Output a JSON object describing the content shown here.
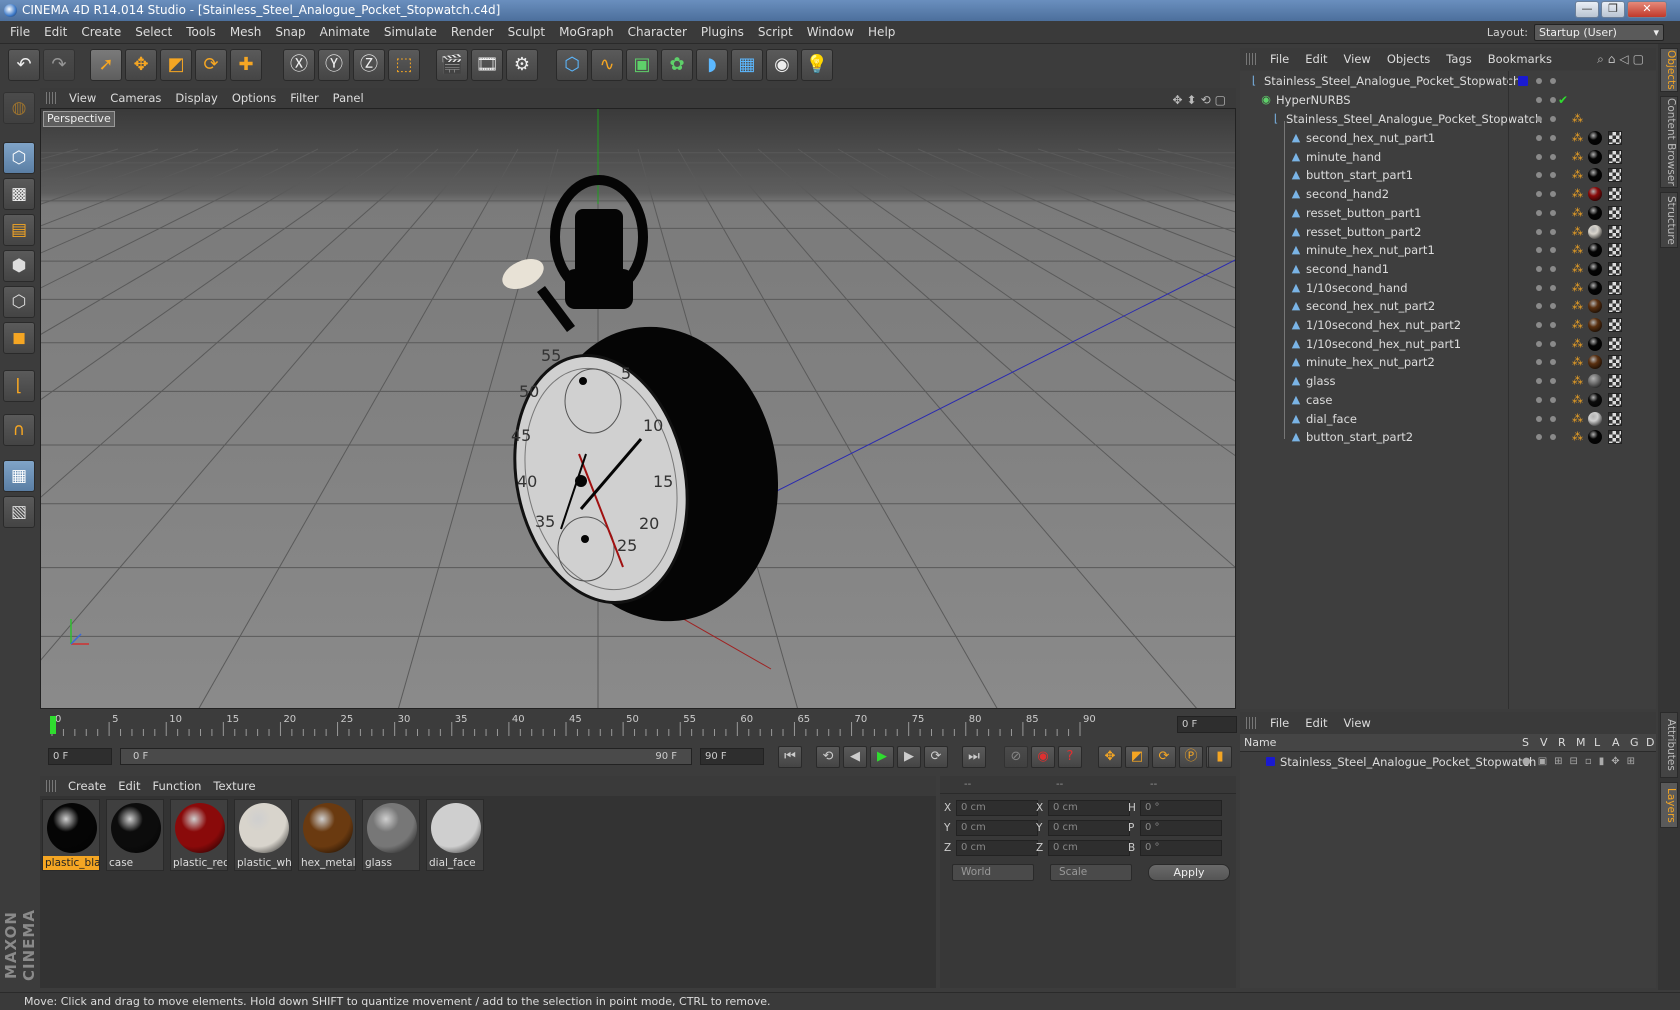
{
  "window": {
    "title": "CINEMA 4D R14.014 Studio - [Stainless_Steel_Analogue_Pocket_Stopwatch.c4d]",
    "minimize": "—",
    "maximize": "❐",
    "close": "✕"
  },
  "menu": [
    "File",
    "Edit",
    "Create",
    "Select",
    "Tools",
    "Mesh",
    "Snap",
    "Animate",
    "Simulate",
    "Render",
    "Sculpt",
    "MoGraph",
    "Character",
    "Plugins",
    "Script",
    "Window",
    "Help"
  ],
  "layout": {
    "label": "Layout:",
    "value": "Startup (User)"
  },
  "toolbar_icons": [
    "undo-icon",
    "redo-icon",
    "live-select-icon",
    "move-icon",
    "scale-icon",
    "rotate-icon",
    "add-icon",
    "x-axis-icon",
    "y-axis-icon",
    "z-axis-icon",
    "world-coordinates-icon",
    "render-view-icon",
    "render-picture-viewer-icon",
    "edit-render-settings-icon",
    "cube-icon",
    "spline-icon",
    "nurbs-icon",
    "array-icon",
    "deformer-icon",
    "floor-icon",
    "camera-icon",
    "light-icon"
  ],
  "viewport": {
    "menu": [
      "View",
      "Cameras",
      "Display",
      "Options",
      "Filter",
      "Panel"
    ],
    "label": "Perspective",
    "dial_numbers": [
      "55",
      "50",
      "45",
      "40",
      "35",
      "5",
      "10",
      "15",
      "20",
      "25"
    ]
  },
  "timeline": {
    "ticks": [
      "0",
      "5",
      "10",
      "15",
      "20",
      "25",
      "30",
      "35",
      "40",
      "45",
      "50",
      "55",
      "60",
      "65",
      "70",
      "75",
      "80",
      "85",
      "90"
    ],
    "current_frame": "0 F"
  },
  "transport": {
    "start_field": "0 F",
    "range_start": "0 F",
    "range_end": "90 F",
    "end_field": "90 F"
  },
  "materials": {
    "menu": [
      "Create",
      "Edit",
      "Function",
      "Texture"
    ],
    "items": [
      {
        "name": "plastic_black",
        "label": "plastic_blac",
        "color": "#050505",
        "selected": true
      },
      {
        "name": "case",
        "label": "case",
        "color": "#0c0c0c",
        "selected": false
      },
      {
        "name": "plastic_red",
        "label": "plastic_red",
        "color": "#8a0a0a",
        "selected": false
      },
      {
        "name": "plastic_white",
        "label": "plastic_whi",
        "color": "#d8d4cc",
        "selected": false
      },
      {
        "name": "hex_metal",
        "label": "hex_metal",
        "color": "#6a3a10",
        "selected": false
      },
      {
        "name": "glass",
        "label": "glass",
        "color": "#777777",
        "selected": false
      },
      {
        "name": "dial_face",
        "label": "dial_face",
        "color": "#cfcfcf",
        "selected": false
      }
    ]
  },
  "coordinates": {
    "headers": [
      "--",
      "--",
      "--"
    ],
    "rows": [
      {
        "a": "X",
        "av": "0 cm",
        "b": "X",
        "bv": "0 cm",
        "c": "H",
        "cv": "0 °"
      },
      {
        "a": "Y",
        "av": "0 cm",
        "b": "Y",
        "bv": "0 cm",
        "c": "P",
        "cv": "0 °"
      },
      {
        "a": "Z",
        "av": "0 cm",
        "b": "Z",
        "bv": "0 cm",
        "c": "B",
        "cv": "0 °"
      }
    ],
    "mode": "World",
    "type": "Scale",
    "apply": "Apply"
  },
  "object_manager": {
    "menu": [
      "File",
      "Edit",
      "View",
      "Objects",
      "Tags",
      "Bookmarks"
    ],
    "root": "Stainless_Steel_Analogue_Pocket_Stopwatch",
    "nurbs": "HyperNURBS",
    "group": "Stainless_Steel_Analogue_Pocket_Stopwatch",
    "children": [
      {
        "name": "second_hex_nut_part1",
        "mat": "#050505"
      },
      {
        "name": "minute_hand",
        "mat": "#050505"
      },
      {
        "name": "button_start_part1",
        "mat": "#050505"
      },
      {
        "name": "second_hand2",
        "mat": "#8a0a0a"
      },
      {
        "name": "resset_button_part1",
        "mat": "#050505"
      },
      {
        "name": "resset_button_part2",
        "mat": "#d8d4cc"
      },
      {
        "name": "minute_hex_nut_part1",
        "mat": "#050505"
      },
      {
        "name": "second_hand1",
        "mat": "#050505"
      },
      {
        "name": "1/10second_hand",
        "mat": "#050505"
      },
      {
        "name": "second_hex_nut_part2",
        "mat": "#5a3010"
      },
      {
        "name": "1/10second_hex_nut_part2",
        "mat": "#5a3010"
      },
      {
        "name": "1/10second_hex_nut_part1",
        "mat": "#050505"
      },
      {
        "name": "minute_hex_nut_part2",
        "mat": "#5a3010"
      },
      {
        "name": "glass",
        "mat": "#777777"
      },
      {
        "name": "case",
        "mat": "#0c0c0c"
      },
      {
        "name": "dial_face",
        "mat": "#cfcfcf"
      },
      {
        "name": "button_start_part2",
        "mat": "#050505"
      }
    ]
  },
  "layers": {
    "menu": [
      "File",
      "Edit",
      "View"
    ],
    "columns": [
      "Name",
      "S",
      "V",
      "R",
      "M",
      "L",
      "A",
      "G",
      "D"
    ],
    "row": "Stainless_Steel_Analogue_Pocket_Stopwatch"
  },
  "right_tabs": [
    "Objects",
    "Content Browser",
    "Structure",
    "Attributes",
    "Layers"
  ],
  "brand": "MAXON CINEMA 4D",
  "status": "Move: Click and drag to move elements. Hold down SHIFT to quantize movement / add to the selection in point mode, CTRL to remove."
}
